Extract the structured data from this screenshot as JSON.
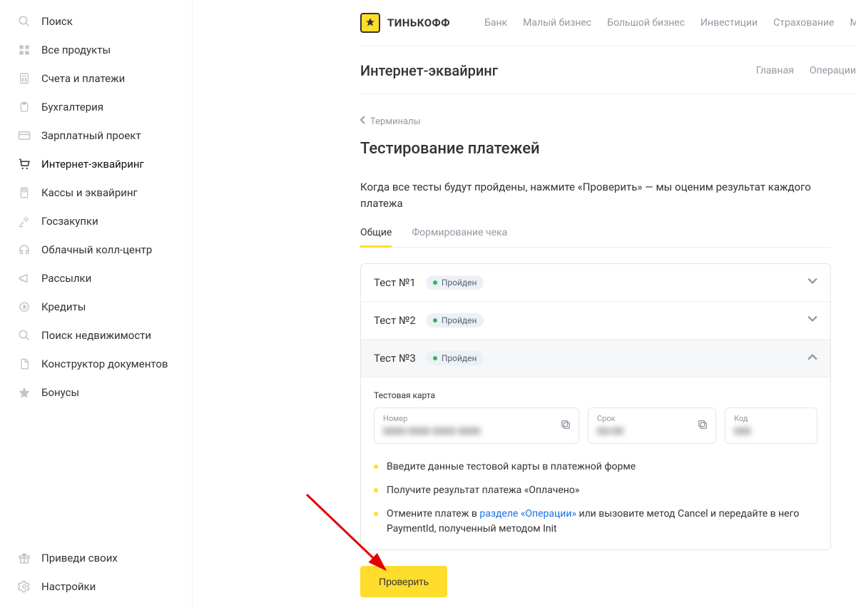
{
  "brand": "ТИНЬКОФФ",
  "topnav": [
    "Банк",
    "Малый бизнес",
    "Большой бизнес",
    "Инвестиции",
    "Страхование",
    "Мобайл"
  ],
  "section": {
    "title": "Интернет-эквайринг",
    "nav": [
      "Главная",
      "Операции"
    ]
  },
  "sidebar": {
    "items": [
      {
        "label": "Поиск",
        "icon": "search"
      },
      {
        "label": "Все продукты",
        "icon": "grid"
      },
      {
        "label": "Счета и платежи",
        "icon": "calc"
      },
      {
        "label": "Бухгалтерия",
        "icon": "clipboard"
      },
      {
        "label": "Зарплатный проект",
        "icon": "card"
      },
      {
        "label": "Интернет-эквайринг",
        "icon": "cart",
        "active": true
      },
      {
        "label": "Кассы и эквайринг",
        "icon": "pos"
      },
      {
        "label": "Госзакупки",
        "icon": "gavel"
      },
      {
        "label": "Облачный колл-центр",
        "icon": "headset"
      },
      {
        "label": "Рассылки",
        "icon": "megaphone"
      },
      {
        "label": "Кредиты",
        "icon": "credit"
      },
      {
        "label": "Поиск недвижимости",
        "icon": "search-home"
      },
      {
        "label": "Конструктор документов",
        "icon": "doc"
      },
      {
        "label": "Бонусы",
        "icon": "star"
      }
    ],
    "bottom": [
      {
        "label": "Приведи своих",
        "icon": "gift"
      },
      {
        "label": "Настройки",
        "icon": "gear"
      }
    ]
  },
  "back": "Терминалы",
  "page_title": "Тестирование платежей",
  "page_desc": "Когда все тесты будут пройдены, нажмите «Проверить» — мы оценим результат каждого платежа",
  "tabs": [
    {
      "label": "Общие",
      "active": true
    },
    {
      "label": "Формирование чека",
      "active": false
    }
  ],
  "tests": [
    {
      "name": "Тест №1",
      "status": "Пройден",
      "expanded": false
    },
    {
      "name": "Тест №2",
      "status": "Пройден",
      "expanded": false
    },
    {
      "name": "Тест №3",
      "status": "Пройден",
      "expanded": true
    }
  ],
  "test_card": {
    "section_label": "Тестовая карта",
    "number_label": "Номер",
    "number_value": "0000 0000 0000 0000",
    "exp_label": "Срок",
    "exp_value": "00/00",
    "cvc_label": "Код",
    "cvc_value": "000"
  },
  "steps": {
    "s1": "Введите данные тестовой карты в платежной форме",
    "s2": "Получите результат платежа «Оплачено»",
    "s3a": "Отмените платеж в ",
    "s3link": "разделе «Операции»",
    "s3b": " или вызовите метод Cancel и передайте в него PaymentId, полученный методом Init"
  },
  "verify_button": "Проверить"
}
